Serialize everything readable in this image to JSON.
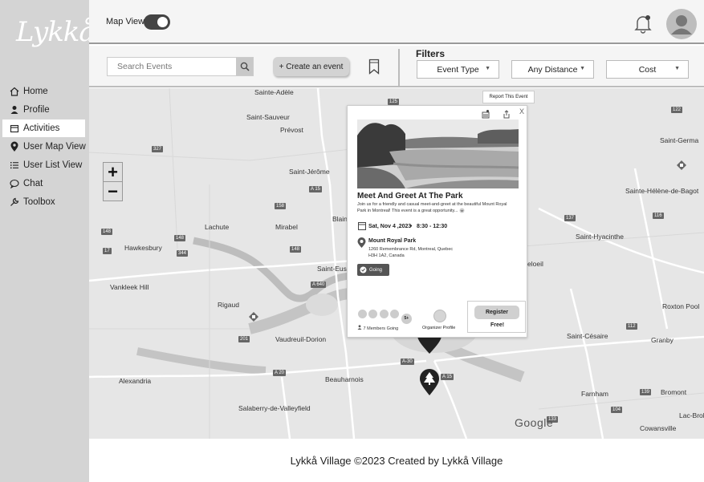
{
  "sidebar": {
    "logo": "Lykkå",
    "items": [
      {
        "label": "Home",
        "icon": "home-icon"
      },
      {
        "label": "Profile",
        "icon": "person-icon"
      },
      {
        "label": "Activities",
        "icon": "calendar-icon",
        "active": true
      },
      {
        "label": "User Map View",
        "icon": "map-pin-icon"
      },
      {
        "label": "User List View",
        "icon": "list-icon"
      },
      {
        "label": "Chat",
        "icon": "chat-icon"
      },
      {
        "label": "Toolbox",
        "icon": "wrench-icon"
      }
    ]
  },
  "header": {
    "map_view_label": "Map View",
    "map_view_toggle_on": true
  },
  "toolbar": {
    "search_placeholder": "Search Events",
    "create_label": "+ Create an event",
    "filters_title": "Filters",
    "filters": [
      {
        "label": "Event Type"
      },
      {
        "label": "Any Distance"
      },
      {
        "label": "Cost"
      }
    ]
  },
  "map": {
    "zoom_in": "+",
    "zoom_out": "−",
    "provider": "Google",
    "places": [
      "Sainte-Adèle",
      "Saint-Sauveur",
      "Prévost",
      "Saint-Jérôme",
      "Lachute",
      "Mirabel",
      "Blain",
      "Hawkesbury",
      "Vankleek Hill",
      "Rigaud",
      "Saint-Eust",
      "Vaudreuil-Dorion",
      "Alexandria",
      "Beauharnois",
      "Salaberry-de-Valleyfield",
      "Saint-Germa",
      "Sainte-Hélène-de-Bagot",
      "Saint-Hyacinthe",
      "eloeil",
      "Roxton Pool",
      "Saint-Césaire",
      "Granby",
      "Farnham",
      "Bromont",
      "Lac-Brol",
      "Cowansville"
    ],
    "routes": [
      "125",
      "122",
      "327",
      "A 15",
      "158",
      "148",
      "148",
      "17",
      "344",
      "148",
      "A 640",
      "201",
      "A 20",
      "A-30",
      "A 15",
      "137",
      "116",
      "112",
      "139",
      "104",
      "133"
    ]
  },
  "popup": {
    "report_label": "Report This Event",
    "close": "X",
    "title": "Meet And Greet At The Park",
    "description": "Join us for a friendly and casual meet-and-greet at the beautiful Mount Royal Park in  Montreal! This event is a great opportunity...",
    "date": "Sat, Nov 4 ,2023",
    "time": "8:30 - 12:30",
    "venue": "Mount Royal Park",
    "address_line1": "1260 Remembrance Rd, Montreal, Quebec",
    "address_line2": "H3H 1A2, Canada",
    "going_label": "Going",
    "members_more": "5+",
    "members_label": "7 Members Going",
    "organizer_label": "Organizer Profile",
    "register_label": "Register",
    "price_label": "Free!"
  },
  "footer": {
    "text": "Lykkå Village ©2023 Created by Lykkå Village"
  }
}
